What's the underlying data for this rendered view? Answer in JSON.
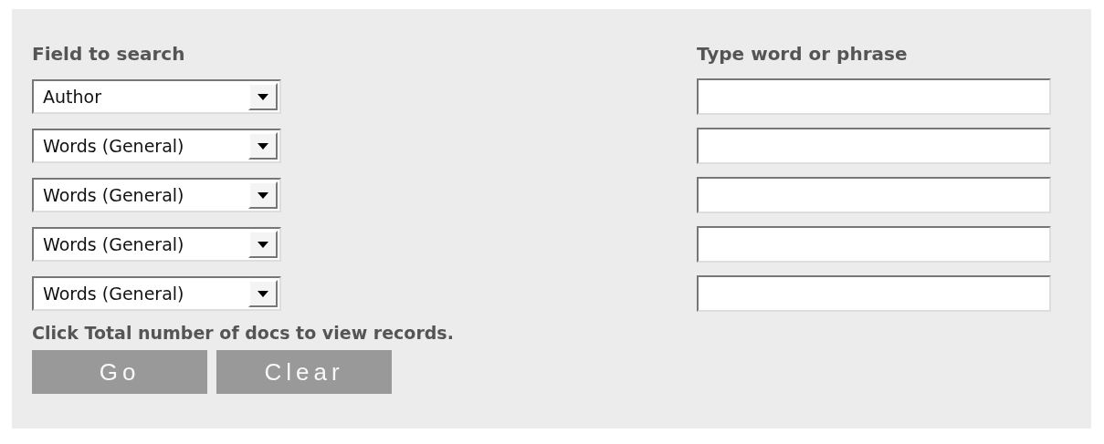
{
  "search_form": {
    "field_heading": "Field to search",
    "term_heading": "Type word or phrase",
    "rows": [
      {
        "field": "Author"
      },
      {
        "field": "Words (General)"
      },
      {
        "field": "Words (General)"
      },
      {
        "field": "Words (General)"
      },
      {
        "field": "Words (General)"
      }
    ],
    "note": "Click Total number of docs to view records.",
    "buttons": [
      "Go",
      "Clear"
    ]
  }
}
